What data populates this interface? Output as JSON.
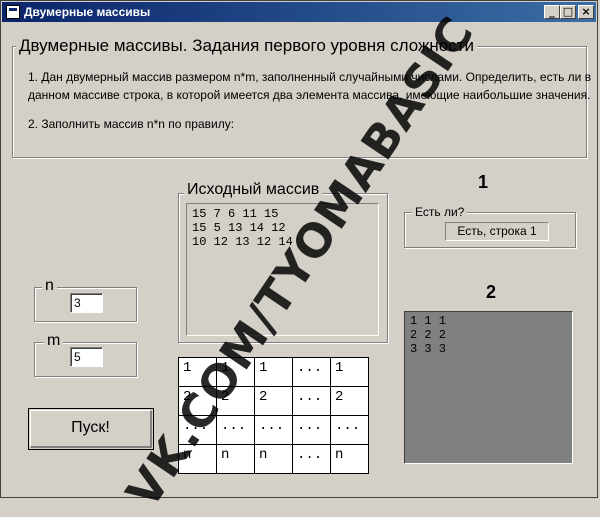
{
  "window": {
    "title": "Двумерные массивы",
    "buttons": {
      "minimize": "_",
      "maximize": "□",
      "close": "×"
    }
  },
  "tasks": {
    "heading": "Двумерные массивы. Задания первого уровня сложности",
    "task1_line1": "1.  Дан двумерный массив размером n*m, заполненный случайными числами. Определить, есть ли в",
    "task1_line2": "данном массиве строка, в которой имеется два элемента массива, имеющие наибольшие значения.",
    "task2": "2.  Заполнить массив n*n по правилу:"
  },
  "source_array": {
    "label": "Исходный массив",
    "lines": [
      "15  7  6  11  15",
      "15  5  13  14  12",
      "10  12  13  12  14"
    ]
  },
  "n_field": {
    "label": "n",
    "value": "3"
  },
  "m_field": {
    "label": "m",
    "value": "5"
  },
  "run_button": {
    "label": "Пуск!"
  },
  "rule_table": {
    "rows": [
      [
        "1",
        "1",
        "1",
        "...",
        "1"
      ],
      [
        "2",
        "2",
        "2",
        "...",
        "2"
      ],
      [
        "...",
        "...",
        "...",
        "...",
        "..."
      ],
      [
        "n",
        "n",
        "n",
        "...",
        "n"
      ]
    ]
  },
  "section1": {
    "number": "1",
    "label": "Есть ли?",
    "value": "Есть, строка 1"
  },
  "section2": {
    "number": "2",
    "lines": [
      "1  1  1",
      "2  2  2",
      "3  3  3"
    ],
    "bg_color": "#808080"
  },
  "watermark": "VK.COM/TYOMABASIC",
  "colors": {
    "titlebar_start": "#0a246a",
    "titlebar_end": "#3a6ea5",
    "face": "#d4d0c8"
  }
}
